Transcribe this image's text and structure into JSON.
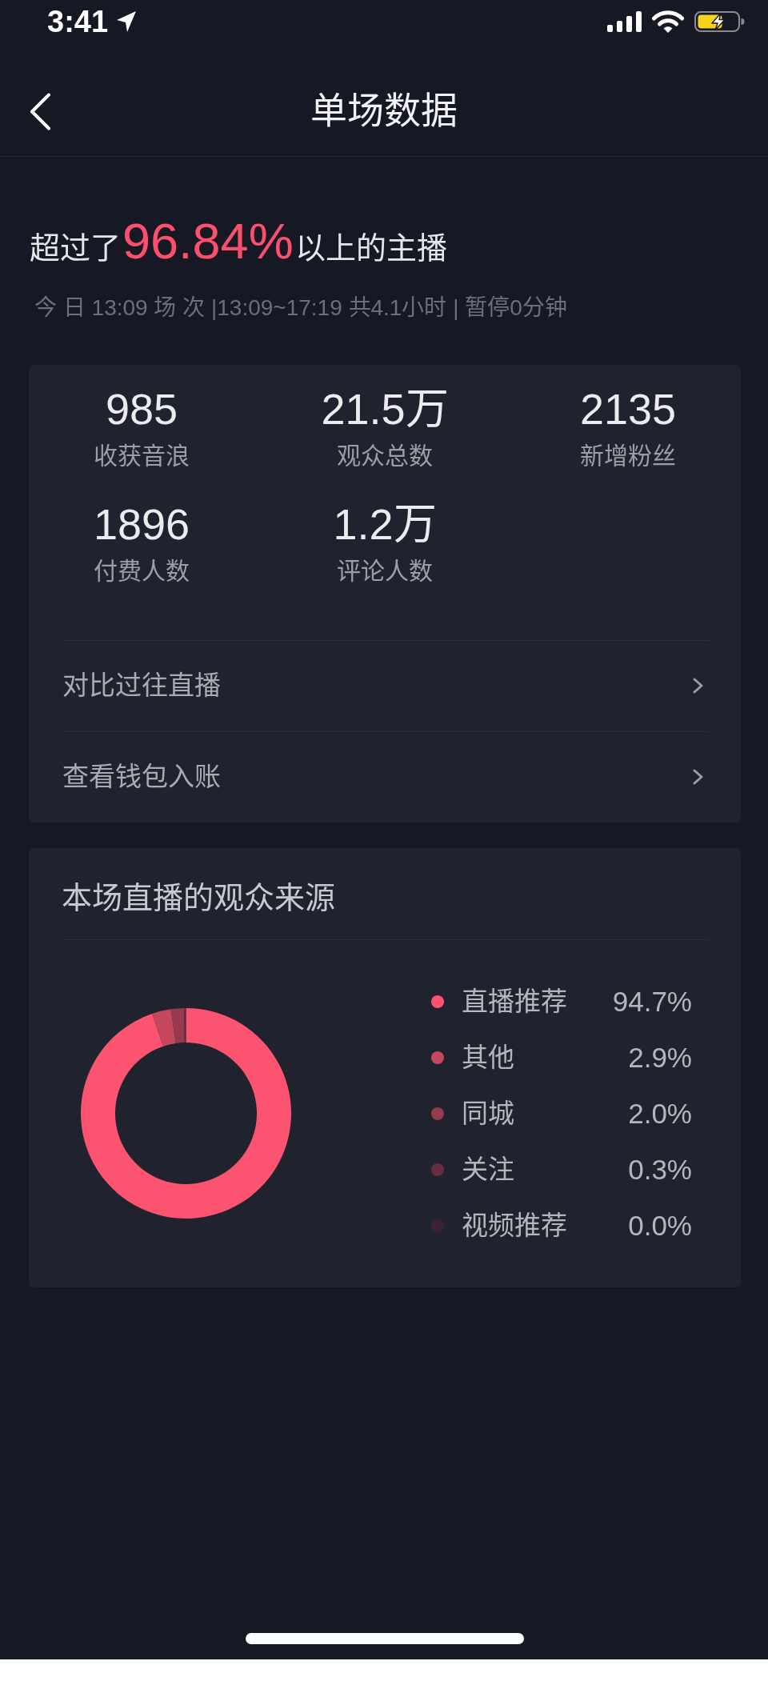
{
  "status_bar": {
    "time": "3:41"
  },
  "nav": {
    "title": "单场数据"
  },
  "summary": {
    "headline": "超过了**96.84%**以上的主播",
    "detail": "今 日 13:09 场 次 |13:09~17:19 共4.1小时 | 暂停0分钟"
  },
  "stats": [
    {
      "value": "985",
      "label": "收获音浪"
    },
    {
      "value": "21.5万",
      "label": "观众总数"
    },
    {
      "value": "2135",
      "label": "新增粉丝"
    },
    {
      "value": "1896",
      "label": "付费人数"
    },
    {
      "value": "1.2万",
      "label": "评论人数"
    }
  ],
  "links": [
    {
      "label": "对比过往直播"
    },
    {
      "label": "查看钱包入账"
    }
  ],
  "sources": {
    "title": "本场直播的观众来源",
    "chart_data": {
      "type": "donut",
      "values": [
        94.7,
        2.9,
        2.0,
        0.3,
        0.0
      ]
    },
    "legend": [
      {
        "label": "直播推荐",
        "value": "94.7%",
        "color": "#fc5470"
      },
      {
        "label": "其他",
        "value": "2.9%",
        "color": "#c6485e"
      },
      {
        "label": "同城",
        "value": "2.0%",
        "color": "#963b4e"
      },
      {
        "label": "关注",
        "value": "0.3%",
        "color": "#672c3d"
      },
      {
        "label": "视频推荐",
        "value": "0.0%",
        "color": "#3b2332"
      }
    ]
  }
}
